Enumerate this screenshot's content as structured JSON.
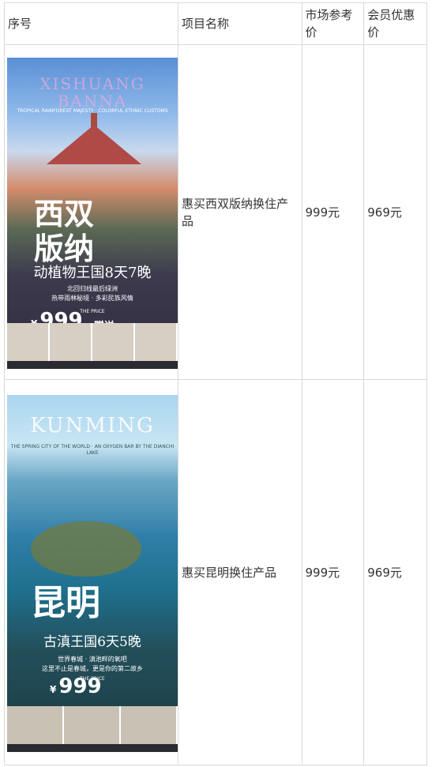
{
  "table": {
    "headers": [
      "序号",
      "项目名称",
      "市场参考价",
      "会员优惠价"
    ],
    "rows": [
      {
        "poster": {
          "en_title": "XISHUANG BANNA",
          "en_sub": "TROPICAL RAINFOREST MAJESTY · COLORFUL ETHNIC CUSTOMS",
          "cn_title": "西双版纳",
          "subtitle": "动植物王国8天7晚",
          "line1": "北回归线最后绿洲",
          "line2": "热带雨林秘境 · 多彩民族风情",
          "price_tag": "THE PRICE",
          "price_prefix": "¥",
          "price": "999",
          "gift": "赠送"
        },
        "name": "惠买西双版纳换住产品",
        "market_price": "999元",
        "member_price": "969元"
      },
      {
        "poster": {
          "en_title": "KUNMING",
          "en_sub": "THE SPRING CITY OF THE WORLD · AN OXYGEN BAR BY THE DIANCHI LAKE",
          "cn_title": "昆明",
          "subtitle": "古滇王国6天5晚",
          "line1": "世界春城 · 滇池畔的氧吧",
          "line2": "这里不止是春城，更是你的第二故乡",
          "price_tag": "THE PRICE",
          "price_prefix": "¥",
          "price": "999",
          "gift": ""
        },
        "name": "惠买昆明换住产品",
        "market_price": "999元",
        "member_price": "969元"
      }
    ]
  },
  "colors": {
    "border": "#d9d9d9",
    "text": "#333333"
  }
}
